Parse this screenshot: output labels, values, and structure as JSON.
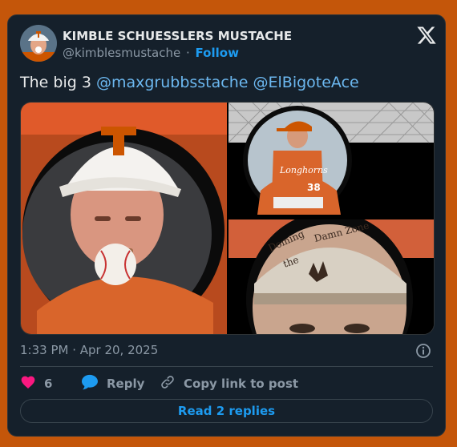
{
  "tweet": {
    "author_name": "KIMBLE SCHUESSLERS MUSTACHE",
    "author_handle": "@kimblesmustache",
    "separator": "·",
    "follow_label": "Follow",
    "text_prefix": "The big 3",
    "mention_1": "@maxgrubbsstache",
    "mention_2": "@ElBigoteAce",
    "timestamp": "1:33 PM · Apr 20, 2025"
  },
  "actions": {
    "like_count": "6",
    "reply_label": "Reply",
    "copy_link_label": "Copy link to post"
  },
  "footer": {
    "read_replies_label": "Read 2 replies"
  },
  "icons": [
    "x-logo-icon",
    "info-icon",
    "heart-icon",
    "reply-bubble-icon",
    "link-icon"
  ],
  "colors": {
    "background": "#c4560a",
    "card": "#15202b",
    "accent": "#1d9bf0",
    "mention": "#6cb8f0",
    "heart": "#f91880",
    "texas_orange": "#cc5500"
  },
  "media": {
    "hat_text": "Doming the Damn Zone",
    "jersey_text": "Longhorns",
    "jersey_number": "38"
  }
}
